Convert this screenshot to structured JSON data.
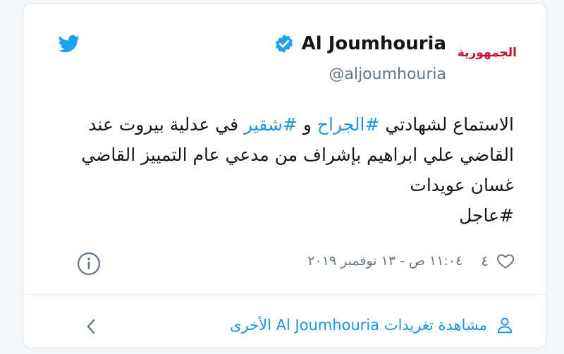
{
  "colors": {
    "accent": "#1b95e0",
    "text": "#14171a",
    "muted": "#657786",
    "brand": "#c8102e"
  },
  "header": {
    "display_name": "Al Joumhouria",
    "handle": "@aljoumhouria",
    "logo_text": "الجمهورية",
    "icons": [
      "twitter-bird-icon",
      "verified-badge-icon"
    ]
  },
  "tweet": {
    "text_1": "الاستماع لشهادتي ",
    "hashtag_1": "#الجراح",
    "text_2": " و ",
    "hashtag_2": "#شقير",
    "text_3": " في عدلية بيروت عند القاضي علي ابراهيم بإشراف من مدعي عام التمييز القاضي غسان عويدات",
    "line_last": "#عاجل",
    "like_count": "٤",
    "timestamp": "١١:٠٤ ص - ١٣ نوفمبر ٢٠١٩"
  },
  "footer": {
    "more_tweets_label": "مشاهدة تغريدات Al Joumhouria الأخرى",
    "icons": [
      "person-icon",
      "chevron-left-icon",
      "info-icon",
      "heart-icon"
    ]
  }
}
